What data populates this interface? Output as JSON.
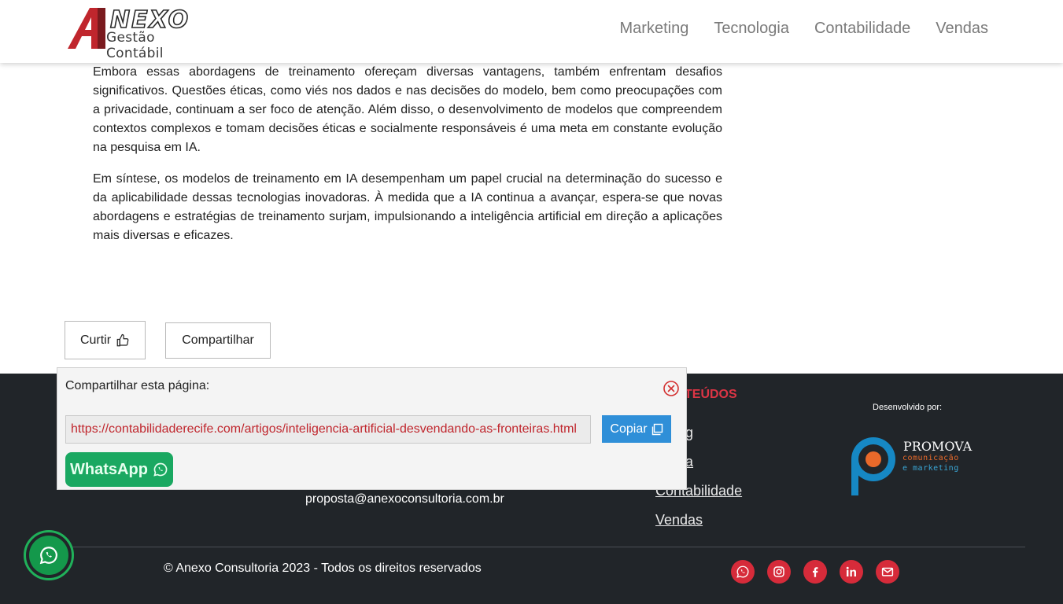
{
  "header": {
    "logo": {
      "mark": "A",
      "word": "NEXO",
      "sub": "Gestão Contábil"
    },
    "nav": [
      {
        "label": "Marketing"
      },
      {
        "label": "Tecnologia"
      },
      {
        "label": "Contabilidade"
      },
      {
        "label": "Vendas"
      }
    ]
  },
  "article": {
    "paragraphs": [
      "Embora essas abordagens de treinamento ofereçam diversas vantagens, também enfrentam desafios significativos. Questões éticas, como viés nos dados e nas decisões do modelo, bem como preocupações com a privacidade, continuam a ser foco de atenção. Além disso, o desenvolvimento de modelos que compreendem contextos complexos e tomam decisões éticas e socialmente responsáveis é uma meta em constante evolução na pesquisa em IA.",
      "Em síntese, os modelos de treinamento em IA desempenham um papel crucial na determinação do sucesso e da aplicabilidade dessas tecnologias inovadoras. À medida que a IA continua a avançar, espera-se que novas abordagens e estratégias de treinamento surjam, impulsionando a inteligência artificial em direção a aplicações mais diversas e eficazes."
    ]
  },
  "actions": {
    "like_label": "Curtir",
    "like_icon": "thumbs-up-icon",
    "share_label": "Compartilhar"
  },
  "share_popup": {
    "title": "Compartilhar esta página:",
    "url": "https://contabilidaderecife.com/artigos/inteligencia-artificial-desvendando-as-fronteiras.html",
    "copy_label": "Copiar",
    "whatsapp_label": "WhatsApp",
    "close_icon": "close-circle-icon"
  },
  "footer": {
    "contents_heading": "TEÚDOS",
    "links": [
      {
        "label": "keting"
      },
      {
        "label": "ologia"
      },
      {
        "label": "Contabilidade"
      },
      {
        "label": "Vendas"
      }
    ],
    "email": "proposta@anexoconsultoria.com.br",
    "developed_by": "Desenvolvido por:",
    "promova": {
      "name": "PROMOVA",
      "line1": "comunicação",
      "line2": "e marketing"
    },
    "copyright": "© Anexo Consultoria 2023 - Todos os direitos reservados",
    "social": [
      "whatsapp-icon",
      "instagram-icon",
      "facebook-icon",
      "linkedin-icon",
      "email-icon"
    ]
  },
  "colors": {
    "accent_red": "#d62b3a",
    "footer_bg": "#212529",
    "copy_blue": "#2f8fd8",
    "whatsapp_green": "#1aa861"
  }
}
